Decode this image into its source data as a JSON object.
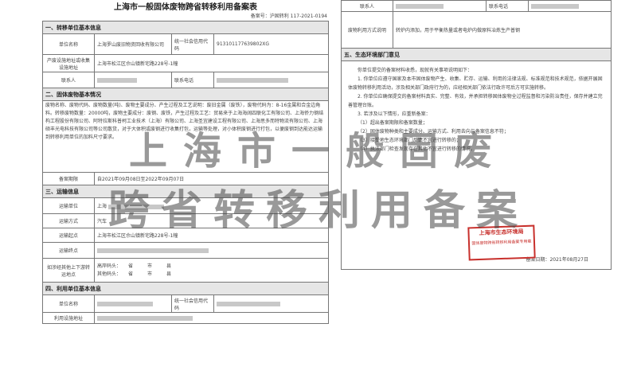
{
  "left": {
    "title": "上海市一般固体废物跨省转移利用备案表",
    "doc_no": "备案号：沪固转利 117-2021-0194",
    "sec1": "一、转移单位基本信息",
    "unit_name_label": "单位名称",
    "unit_name_value": "上海罗山废旧物资回收有限公司",
    "credit_label": "统一社会信用代码",
    "credit_value": "913101177639802XG",
    "address_label": "产废设施地址或收集设施地址",
    "address_value": "上海市松江区佘山镇新宅路228号-1幢",
    "contact_label": "联系人",
    "contact_value": "",
    "phone_label": "联系电话",
    "phone_value": "",
    "sec2": "二、固体废物基本情况",
    "waste_text": "废物名称、废物代码、废物数量(吨)、废物主要成分、产生过程及工艺说明：废旧金属（废铁），废物代码为：8-16金属和合金边角料。转移废物数量：20000吨，废物主要成分：废钢、废铁，产生过程及工艺：贸易来于上海海阔四联化工有限公司、上海侨力钢结构工程股份有限公司、阿特拉斯科普柯工业技术（上海）有限公司、上海圣宜建设工程有限公司、上海思多而特物流有限公司、上海硕丰光电科技有限公司等公司散货，对于大体积或废钢进行收集打包，运输等处理，对小体积废钢进行打包，以便废钢到达能达运输到转移利用单位的加料尺寸要求。",
    "period_label": "备案期限",
    "period_value": "自2021年09月08日至2022年09月07日",
    "sec3": "三、运输信息",
    "carrier_label": "运输单位",
    "carrier_value": "上海",
    "mode_label": "运输方式",
    "mode_value": "汽车",
    "start_label": "运输起点",
    "start_value": "上海市松江区佘山镇新宅路228号-1幢",
    "end_label": "运输终点",
    "end_value": "",
    "transship_label": "如涉经其他上下游转运地点",
    "transship_line1": "高岸码头：　　省　　　市　　　县",
    "transship_line2": "其他码头：　　省　　　市　　　县",
    "sec4": "四、利用单位基本信息",
    "user_unit_label": "单位名称",
    "user_credit_label": "统一社会信用代码",
    "user_address_label": "利用设施地址"
  },
  "right": {
    "contact_label": "联系人",
    "phone_label": "联系电话",
    "method_label": "废物利用方式说明",
    "method_value": "转炉内添加，用于平衡热量或者电炉内做原料冶炼生产普钢",
    "sec5": "五、生态环境部门意见",
    "opinion_p1": "你单位提交的备案材料收悉，现就有关事项说明如下：",
    "opinion_p2": "1. 你单位应遵守国家及本市固体废物产生、收集、贮存、运输、利用的法律法规、标准规范和技术规范，依据开展固体废物转移利用活动，涉及相关部门政府行为的，应经相关部门依法行政许可后方可实施转移。",
    "opinion_p3": "2. 你单位应确保提交的备案材料真实、完整、有效，并承担转移固体废物全过程监督和污染防治责任，保存并建立完善管理台账。",
    "opinion_p4": "3. 若涉及以下情形，应重新备案：",
    "opinion_items": [
      "（1）超出备案期限和备案数量；",
      "（2）固体废物种类和主要成分、运输方式、利用去向与备案信息不符；",
      "（3）接受地生态环境部门反馈不宜进行转移的；",
      "（4）执法部门检查发现存在其他不宜进行转移的情况。"
    ],
    "stamp_line1": "上海市生态环境局",
    "stamp_line2": "固体废物跨省转移利用备案专用章",
    "date_label": "备案日期：",
    "date_value": "2021年08月27日"
  },
  "watermark": {
    "line1": "上海市一般固废",
    "line2": "跨省转移利用备案"
  }
}
